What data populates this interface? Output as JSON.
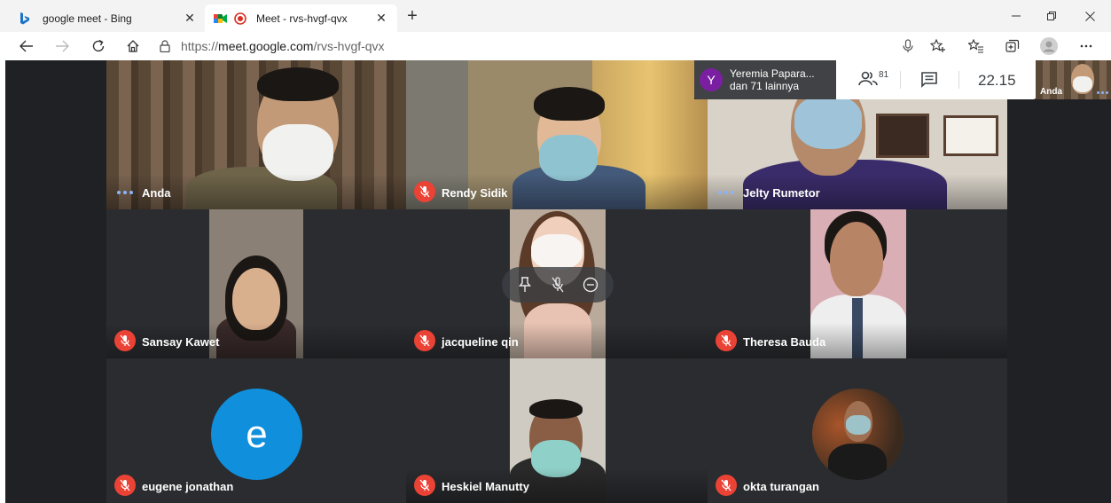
{
  "browser": {
    "tabs": [
      {
        "title": "google meet - Bing",
        "active": false
      },
      {
        "title": "Meet - rvs-hvgf-qvx",
        "active": true
      }
    ],
    "url": {
      "protocol": "https://",
      "host": "meet.google.com",
      "path": "/rvs-hvgf-qvx"
    }
  },
  "meet": {
    "presenter": {
      "initial": "Y",
      "name": "Yeremia Papara...",
      "others": "dan 71 lainnya"
    },
    "participant_count": "81",
    "clock": "22.15",
    "self_view_label": "Anda",
    "tiles": [
      {
        "name": "Anda",
        "muted": false
      },
      {
        "name": "Rendy Sidik",
        "muted": true
      },
      {
        "name": "Jelty Rumetor",
        "muted": false
      },
      {
        "name": "Sansay Kawet",
        "muted": true
      },
      {
        "name": "jacqueline qin",
        "muted": true
      },
      {
        "name": "Theresa Bauda",
        "muted": true
      },
      {
        "name": "eugene jonathan",
        "muted": true,
        "avatar_letter": "e"
      },
      {
        "name": "Heskiel Manutty",
        "muted": true
      },
      {
        "name": "okta turangan",
        "muted": true
      }
    ]
  },
  "colors": {
    "meet_bg": "#202124",
    "mute_red": "#ea4335",
    "avatar_blue": "#0f8fdc",
    "presenter_purple": "#7b1fa2"
  }
}
